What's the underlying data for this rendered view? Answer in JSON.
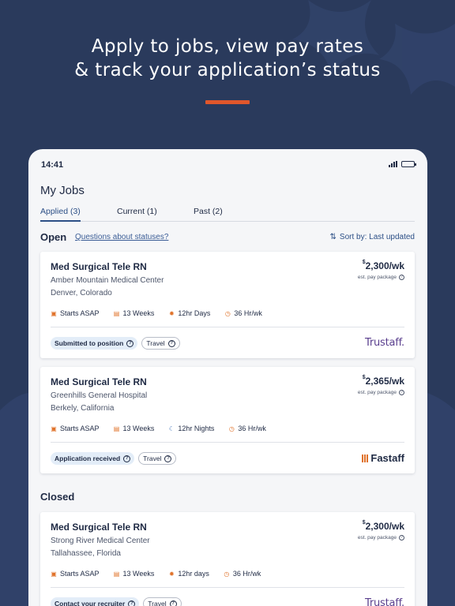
{
  "headline": {
    "line1": "Apply to jobs, view pay rates",
    "line2": "& track your application’s status"
  },
  "colors": {
    "background": "#2a3a5c",
    "accent": "#e0572b",
    "link": "#2c4f86",
    "trustaff": "#5a3f8e"
  },
  "status_bar": {
    "time": "14:41"
  },
  "page": {
    "title": "My Jobs"
  },
  "tabs": [
    {
      "label": "Applied (3)",
      "active": true
    },
    {
      "label": "Current (1)",
      "active": false
    },
    {
      "label": "Past (2)",
      "active": false
    }
  ],
  "open_section": {
    "title": "Open",
    "link": "Questions about statuses?",
    "sort_label": "Sort by: Last updated"
  },
  "closed_section": {
    "title": "Closed"
  },
  "jobs": [
    {
      "title": "Med Surgical Tele RN",
      "facility": "Amber Mountain Medical Center",
      "location": "Denver, Colorado",
      "pay_symbol": "$",
      "pay": "2,300/wk",
      "pay_note": "est. pay package",
      "start": "Starts ASAP",
      "duration": "13 Weeks",
      "shift": "12hr Days",
      "hours": "36 Hr/wk",
      "status": "Submitted to position",
      "type": "Travel",
      "brand": "Trustaff."
    },
    {
      "title": "Med Surgical Tele RN",
      "facility": "Greenhills General Hospital",
      "location": "Berkely, California",
      "pay_symbol": "$",
      "pay": "2,365/wk",
      "pay_note": "est. pay package",
      "start": "Starts ASAP",
      "duration": "13 Weeks",
      "shift": "12hr Nights",
      "hours": "36 Hr/wk",
      "status": "Application received",
      "type": "Travel",
      "brand": "Fastaff"
    },
    {
      "title": "Med Surgical Tele RN",
      "facility": "Strong River Medical Center",
      "location": "Tallahassee, Florida",
      "pay_symbol": "$",
      "pay": "2,300/wk",
      "pay_note": "est. pay package",
      "start": "Starts ASAP",
      "duration": "13 Weeks",
      "shift": "12hr days",
      "hours": "36 Hr/wk",
      "status": "Contact your recruiter",
      "type": "Travel",
      "brand": "Trustaff."
    }
  ]
}
